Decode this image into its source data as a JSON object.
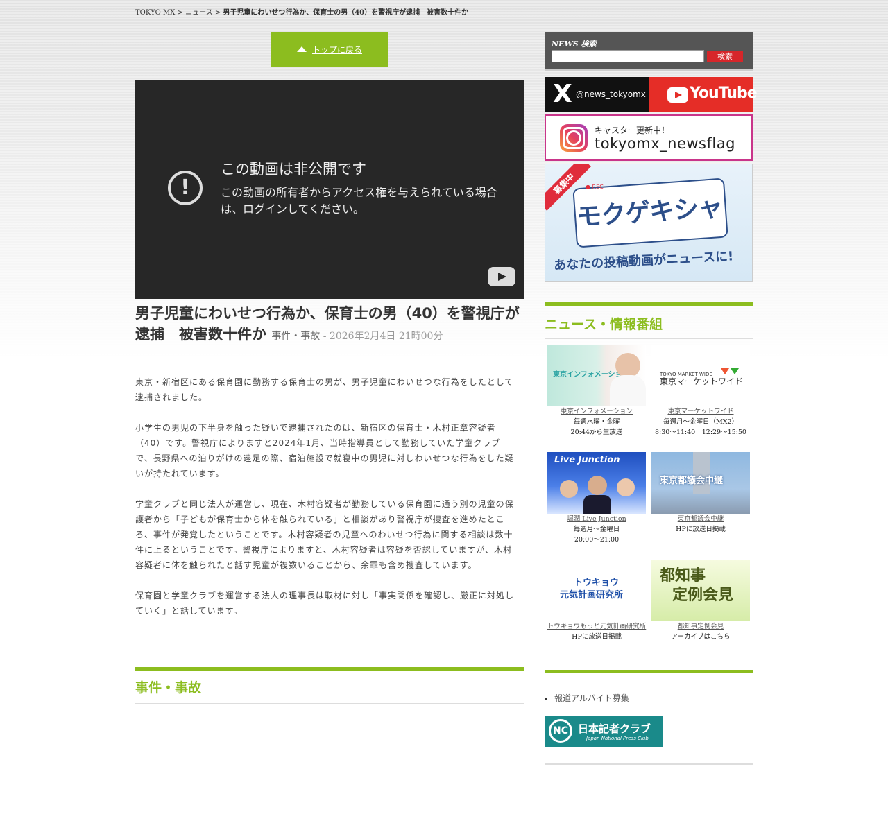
{
  "breadcrumb": {
    "home": "TOKYO MX",
    "sep1": " > ",
    "section": "ニュース",
    "sep2": " > ",
    "current": "男子児童にわいせつ行為か、保育士の男（40）を警視庁が逮捕　被害数十件か"
  },
  "top_button": {
    "label": "トップに戻る"
  },
  "video": {
    "heading": "この動画は非公開です",
    "message": "この動画の所有者からアクセス権を与えられている場合は、ログインしてください。"
  },
  "article": {
    "title": "男子児童にわいせつ行為か、保育士の男（40）を警視庁が逮捕　被害数十件か",
    "category": "事件・事故",
    "date": " - 2026年2月4日 21時00分",
    "paragraphs": [
      "東京・新宿区にある保育園に勤務する保育士の男が、男子児童にわいせつな行為をしたとして逮捕されました。",
      "小学生の男児の下半身を触った疑いで逮捕されたのは、新宿区の保育士・木村正章容疑者（40）です。警視庁によりますと2024年1月、当時指導員として勤務していた学童クラブで、長野県への泊りがけの遠足の際、宿泊施設で就寝中の男児に対しわいせつな行為をした疑いが持たれています。",
      "学童クラブと同じ法人が運営し、現在、木村容疑者が勤務している保育園に通う別の児童の保護者から「子どもが保育士から体を触られている」と相談があり警視庁が捜査を進めたところ、事件が発覚したということです。木村容疑者の児童へのわいせつ行為に関する相談は数十件に上るということです。警視庁によりますと、木村容疑者は容疑を否認していますが、木村容疑者に体を触られたと話す児童が複数いることから、余罪も含め捜査しています。",
      "保育園と学童クラブを運営する法人の理事長は取材に対し「事実関係を確認し、厳正に対処していく」と話しています。"
    ]
  },
  "related_section": {
    "heading": "事件・事故"
  },
  "search": {
    "label": "NEWS 検索",
    "placeholder": "",
    "button": "検索"
  },
  "social": {
    "x_handle": "@news_tokyomx",
    "x_logo": "X",
    "youtube": "YouTube",
    "instagram_caption": "キャスター更新中！",
    "instagram_handle": "tokyomx_newsflag"
  },
  "mokugeki": {
    "ribbon": "募集中",
    "rec": "● REC",
    "logo": "モクゲキシャ",
    "tagline": "あなたの投稿動画がニュースに!"
  },
  "programs": {
    "heading": "ニュース・情報番組",
    "items": [
      {
        "link": "東京インフォメーション",
        "line1": "毎週水曜・金曜",
        "line2": "20:44から生放送",
        "img_text": "東京インフォメーション"
      },
      {
        "link": "東京マーケットワイド",
        "line1": "毎週月～金曜日（MX2）",
        "line2": "8:30～11:40　12:29～15:50",
        "img_text": "東京マーケットワイド",
        "img_sub": "TOKYO MARKET WIDE"
      },
      {
        "link": "堀潤 Live Junction",
        "line1": "毎週月～金曜日",
        "line2": "20:00～21:00",
        "img_text": "Live Junction"
      },
      {
        "link": "東京都議会中継",
        "line1": "HPに放送日掲載",
        "line2": "",
        "img_text": "東京都議会中継"
      },
      {
        "link": "トウキョウもっと元気計画研究所",
        "line1": "HPに放送日掲載",
        "line2": "",
        "img_text": "トウキョウ",
        "img_sub": "元気計画研究所"
      },
      {
        "link": "都知事定例会見",
        "line1": "アーカイブはこちら",
        "line2": "",
        "img_text": "都知事",
        "img_sub": "定例会見"
      }
    ]
  },
  "side_links": {
    "items": [
      "報道アルバイト募集"
    ]
  },
  "press_club": {
    "logo": "NC",
    "name": "日本記者クラブ",
    "sub": "Japan National Press Club"
  },
  "colors": {
    "accent": "#8cbd1f",
    "search_button": "#d6262a",
    "youtube": "#e52d27"
  }
}
